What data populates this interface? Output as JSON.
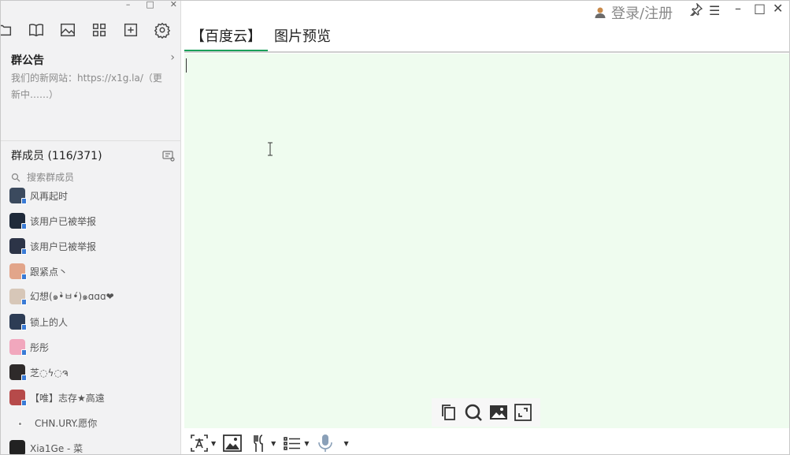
{
  "left": {
    "notice": {
      "title": "群公告",
      "chevron": "›",
      "body": "我们的新网站：https://x1g.la/（更新中……）"
    },
    "members": {
      "title": "群成员 (116/371)",
      "search_placeholder": "搜索群成员",
      "list": [
        {
          "name": "风再起时",
          "color": "#3b4a5e"
        },
        {
          "name": "该用户已被举报",
          "color": "#1f2a3a"
        },
        {
          "name": "该用户已被举报",
          "color": "#2c3447"
        },
        {
          "name": "跟紧点丶",
          "color": "#e2a58a"
        },
        {
          "name": "幻想(๑•̀ㅂ•́)๑ɑɑɑ❤",
          "color": "#d7c7b8"
        },
        {
          "name": "锁上的人",
          "color": "#2d3c55"
        },
        {
          "name": "彤彤",
          "color": "#f1a7bd"
        },
        {
          "name": "芝◌ϟ◌ຈ",
          "color": "#2e2a2a"
        },
        {
          "name": "【唯】志存★高遠",
          "color": "#b64a4a"
        },
        {
          "name": "CHN.URY.愿你",
          "color": "#ffffff"
        },
        {
          "name": "Xia1Ge - 菜",
          "color": "#222222"
        }
      ]
    }
  },
  "right": {
    "login_label": "登录/注册",
    "pin_glyph": "📌",
    "menu_glyph": "☰",
    "min_glyph": "–",
    "max_glyph": "□",
    "close_glyph": "✕",
    "tabs": [
      {
        "label": "【百度云】"
      },
      {
        "label": "图片预览"
      }
    ],
    "editor_bg": "#effcef",
    "accent": "#1aa05a"
  },
  "left_window": {
    "min_glyph": "–",
    "max_glyph": "□",
    "close_glyph": "✕"
  }
}
